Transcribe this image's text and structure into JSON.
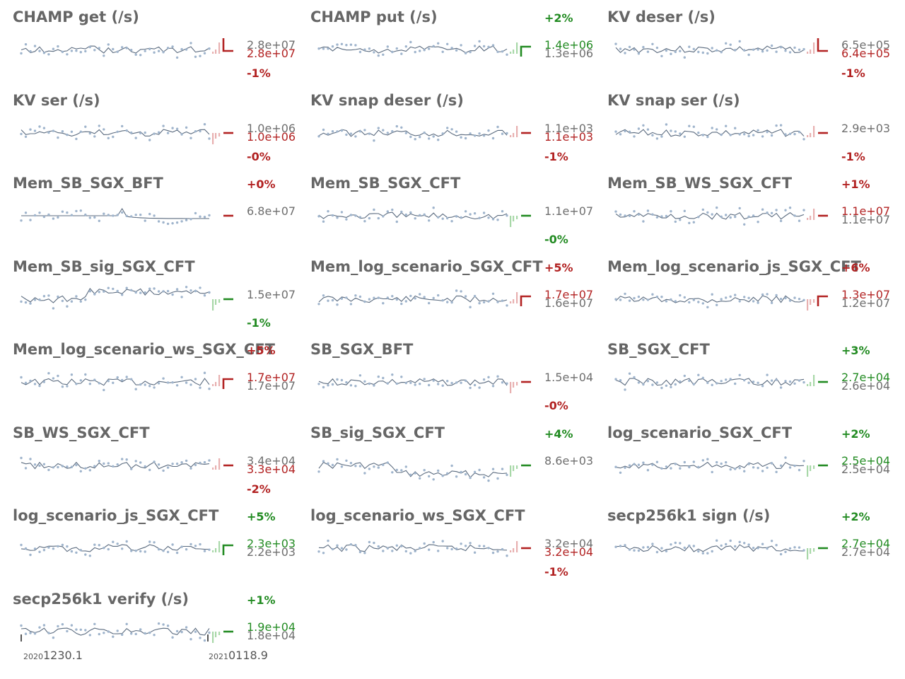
{
  "colors": {
    "up": "#228b22",
    "down": "#b22222",
    "line": "#5b6b7f",
    "dots": "#9fb4cc",
    "title": "#666666"
  },
  "panels": [
    {
      "title": "CHAMP get (/s)",
      "value_a": "2.8e+07",
      "value_b": "2.8e+07",
      "value_a_color": "#6e6e6e",
      "value_b_color": "#b22222",
      "change": "-1%",
      "change_color": "#b22222",
      "change_pos": "below",
      "marker": "down-step",
      "bar_trend": "up",
      "seed": 1
    },
    {
      "title": "CHAMP put (/s)",
      "value_a": "1.4e+06",
      "value_b": "1.3e+06",
      "value_a_color": "#228b22",
      "value_b_color": "#6e6e6e",
      "change": "+2%",
      "change_color": "#228b22",
      "change_pos": "above",
      "marker": "up-step",
      "bar_trend": "up",
      "seed": 2
    },
    {
      "title": "KV deser (/s)",
      "value_a": "6.5e+05",
      "value_b": "6.4e+05",
      "value_a_color": "#6e6e6e",
      "value_b_color": "#b22222",
      "change": "-1%",
      "change_color": "#b22222",
      "change_pos": "below",
      "marker": "down-step",
      "bar_trend": "up",
      "seed": 3
    },
    {
      "title": "KV ser (/s)",
      "value_a": "1.0e+06",
      "value_b": "1.0e+06",
      "value_a_color": "#6e6e6e",
      "value_b_color": "#b22222",
      "change": "-0%",
      "change_color": "#b22222",
      "change_pos": "below",
      "marker": "down-flat",
      "bar_trend": "down",
      "seed": 4
    },
    {
      "title": "KV snap deser (/s)",
      "value_a": "1.1e+03",
      "value_b": "1.1e+03",
      "value_a_color": "#6e6e6e",
      "value_b_color": "#b22222",
      "change": "-1%",
      "change_color": "#b22222",
      "change_pos": "below",
      "marker": "down-flat",
      "bar_trend": "up",
      "seed": 5
    },
    {
      "title": "KV snap ser (/s)",
      "value_a": "2.9e+03",
      "value_b": "",
      "value_a_color": "#6e6e6e",
      "value_b_color": "#b22222",
      "change": "-1%",
      "change_color": "#b22222",
      "change_pos": "below",
      "marker": "down-flat",
      "bar_trend": "up",
      "seed": 6
    },
    {
      "title": "Mem_SB_SGX_BFT",
      "value_a": "6.8e+07",
      "value_b": "",
      "value_a_color": "#6e6e6e",
      "value_b_color": "#6e6e6e",
      "change": "+0%",
      "change_color": "#b22222",
      "change_pos": "above",
      "marker": "down-flat",
      "bar_trend": "none",
      "seed": 7
    },
    {
      "title": "Mem_SB_SGX_CFT",
      "value_a": "1.1e+07",
      "value_b": "",
      "value_a_color": "#6e6e6e",
      "value_b_color": "#228b22",
      "change": "-0%",
      "change_color": "#228b22",
      "change_pos": "below",
      "marker": "up-flat",
      "bar_trend": "down",
      "seed": 8
    },
    {
      "title": "Mem_SB_WS_SGX_CFT",
      "value_a": "1.1e+07",
      "value_b": "1.1e+07",
      "value_a_color": "#b22222",
      "value_b_color": "#6e6e6e",
      "change": "+1%",
      "change_color": "#b22222",
      "change_pos": "above",
      "marker": "down-flat",
      "bar_trend": "up",
      "seed": 9
    },
    {
      "title": "Mem_SB_sig_SGX_CFT",
      "value_a": "1.5e+07",
      "value_b": "",
      "value_a_color": "#6e6e6e",
      "value_b_color": "#228b22",
      "change": "-1%",
      "change_color": "#228b22",
      "change_pos": "below",
      "marker": "up-flat",
      "bar_trend": "down",
      "seed": 10
    },
    {
      "title": "Mem_log_scenario_SGX_CFT",
      "value_a": "1.7e+07",
      "value_b": "1.6e+07",
      "value_a_color": "#b22222",
      "value_b_color": "#6e6e6e",
      "change": "+5%",
      "change_color": "#b22222",
      "change_pos": "above",
      "marker": "down-step-up",
      "bar_trend": "up",
      "seed": 11
    },
    {
      "title": "Mem_log_scenario_js_SGX_CFT",
      "value_a": "1.3e+07",
      "value_b": "1.2e+07",
      "value_a_color": "#b22222",
      "value_b_color": "#6e6e6e",
      "change": "+6%",
      "change_color": "#b22222",
      "change_pos": "above",
      "marker": "down-step-up",
      "bar_trend": "down",
      "seed": 12
    },
    {
      "title": "Mem_log_scenario_ws_SGX_CFT",
      "value_a": "1.7e+07",
      "value_b": "1.7e+07",
      "value_a_color": "#b22222",
      "value_b_color": "#6e6e6e",
      "change": "+5%",
      "change_color": "#b22222",
      "change_pos": "above",
      "marker": "down-step-up",
      "bar_trend": "up",
      "seed": 13
    },
    {
      "title": "SB_SGX_BFT",
      "value_a": "1.5e+04",
      "value_b": "",
      "value_a_color": "#6e6e6e",
      "value_b_color": "#b22222",
      "change": "-0%",
      "change_color": "#b22222",
      "change_pos": "below",
      "marker": "down-flat",
      "bar_trend": "down",
      "seed": 14
    },
    {
      "title": "SB_SGX_CFT",
      "value_a": "2.7e+04",
      "value_b": "2.6e+04",
      "value_a_color": "#228b22",
      "value_b_color": "#6e6e6e",
      "change": "+3%",
      "change_color": "#228b22",
      "change_pos": "above",
      "marker": "up-flat",
      "bar_trend": "up",
      "seed": 15
    },
    {
      "title": "SB_WS_SGX_CFT",
      "value_a": "3.4e+04",
      "value_b": "3.3e+04",
      "value_a_color": "#6e6e6e",
      "value_b_color": "#b22222",
      "change": "-2%",
      "change_color": "#b22222",
      "change_pos": "below",
      "marker": "down-flat",
      "bar_trend": "up",
      "seed": 16
    },
    {
      "title": "SB_sig_SGX_CFT",
      "value_a": "8.6e+03",
      "value_b": "",
      "value_a_color": "#6e6e6e",
      "value_b_color": "#228b22",
      "change": "+4%",
      "change_color": "#228b22",
      "change_pos": "above",
      "marker": "up-flat",
      "bar_trend": "down",
      "seed": 17
    },
    {
      "title": "log_scenario_SGX_CFT",
      "value_a": "2.5e+04",
      "value_b": "2.5e+04",
      "value_a_color": "#228b22",
      "value_b_color": "#6e6e6e",
      "change": "+2%",
      "change_color": "#228b22",
      "change_pos": "above",
      "marker": "up-flat",
      "bar_trend": "down",
      "seed": 18
    },
    {
      "title": "log_scenario_js_SGX_CFT",
      "value_a": "2.3e+03",
      "value_b": "2.2e+03",
      "value_a_color": "#228b22",
      "value_b_color": "#6e6e6e",
      "change": "+5%",
      "change_color": "#228b22",
      "change_pos": "above",
      "marker": "up-step",
      "bar_trend": "up",
      "seed": 19
    },
    {
      "title": "log_scenario_ws_SGX_CFT",
      "value_a": "3.2e+04",
      "value_b": "3.2e+04",
      "value_a_color": "#6e6e6e",
      "value_b_color": "#b22222",
      "change": "-1%",
      "change_color": "#b22222",
      "change_pos": "below",
      "marker": "down-flat",
      "bar_trend": "up",
      "seed": 20
    },
    {
      "title": "secp256k1 sign (/s)",
      "value_a": "2.7e+04",
      "value_b": "2.7e+04",
      "value_a_color": "#228b22",
      "value_b_color": "#6e6e6e",
      "change": "+2%",
      "change_color": "#228b22",
      "change_pos": "above",
      "marker": "up-flat",
      "bar_trend": "down",
      "seed": 21
    },
    {
      "title": "secp256k1 verify (/s)",
      "value_a": "1.9e+04",
      "value_b": "1.8e+04",
      "value_a_color": "#228b22",
      "value_b_color": "#6e6e6e",
      "change": "+1%",
      "change_color": "#228b22",
      "change_pos": "above",
      "marker": "up-flat",
      "bar_trend": "down",
      "seed": 22
    }
  ],
  "x_axis": {
    "start_year": "2020",
    "start_label": "1230.1",
    "end_year": "2021",
    "end_label": "0118.9"
  },
  "chart_data": {
    "type": "line",
    "title": "",
    "xlabel": "",
    "ylabel": "",
    "x_range": [
      "20201230.1",
      "20210118.9"
    ],
    "series": [
      {
        "name": "CHAMP get (/s)",
        "latest": 28000000,
        "change_percent": -1
      },
      {
        "name": "CHAMP put (/s)",
        "latest": 1300000,
        "change_percent": 2
      },
      {
        "name": "KV deser (/s)",
        "latest": 640000,
        "change_percent": -1
      },
      {
        "name": "KV ser (/s)",
        "latest": 1000000,
        "change_percent": 0
      },
      {
        "name": "KV snap deser (/s)",
        "latest": 1100,
        "change_percent": -1
      },
      {
        "name": "KV snap ser (/s)",
        "latest": 2900,
        "change_percent": -1
      },
      {
        "name": "Mem_SB_SGX_BFT",
        "latest": 68000000,
        "change_percent": 0
      },
      {
        "name": "Mem_SB_SGX_CFT",
        "latest": 11000000,
        "change_percent": 0
      },
      {
        "name": "Mem_SB_WS_SGX_CFT",
        "latest": 11000000,
        "change_percent": 1
      },
      {
        "name": "Mem_SB_sig_SGX_CFT",
        "latest": 15000000,
        "change_percent": -1
      },
      {
        "name": "Mem_log_scenario_SGX_CFT",
        "latest": 16000000,
        "change_percent": 5
      },
      {
        "name": "Mem_log_scenario_js_SGX_CFT",
        "latest": 12000000,
        "change_percent": 6
      },
      {
        "name": "Mem_log_scenario_ws_SGX_CFT",
        "latest": 17000000,
        "change_percent": 5
      },
      {
        "name": "SB_SGX_BFT",
        "latest": 15000,
        "change_percent": 0
      },
      {
        "name": "SB_SGX_CFT",
        "latest": 26000,
        "change_percent": 3
      },
      {
        "name": "SB_WS_SGX_CFT",
        "latest": 33000,
        "change_percent": -2
      },
      {
        "name": "SB_sig_SGX_CFT",
        "latest": 8600,
        "change_percent": 4
      },
      {
        "name": "log_scenario_SGX_CFT",
        "latest": 25000,
        "change_percent": 2
      },
      {
        "name": "log_scenario_js_SGX_CFT",
        "latest": 2200,
        "change_percent": 5
      },
      {
        "name": "log_scenario_ws_SGX_CFT",
        "latest": 32000,
        "change_percent": -1
      },
      {
        "name": "secp256k1 sign (/s)",
        "latest": 27000,
        "change_percent": 2
      },
      {
        "name": "secp256k1 verify (/s)",
        "latest": 18000,
        "change_percent": 1
      }
    ],
    "grid": false,
    "legend": "none"
  }
}
